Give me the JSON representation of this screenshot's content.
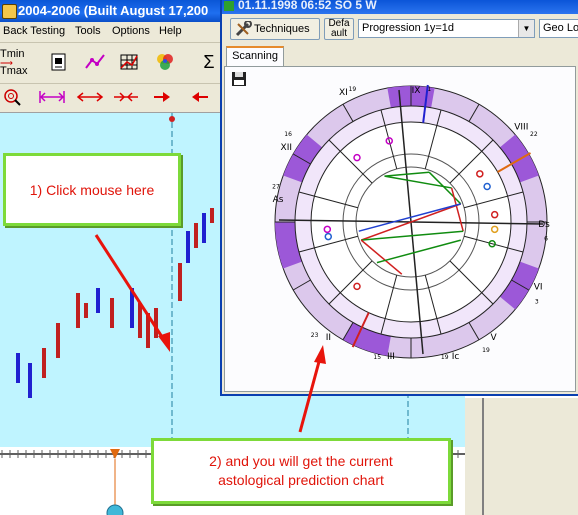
{
  "app": {
    "title": "2004-2006 (Built August 17,200"
  },
  "menu": {
    "items": [
      "Back Testing",
      "Tools",
      "Options",
      "Help"
    ]
  },
  "toolbar": {
    "tmin_label": "Tmin",
    "tmax_label": "Tmax",
    "sigma_label": "Σ"
  },
  "popup": {
    "title": "01.11.1998  06:52 SO  5 W",
    "techniques_label": "Techniques",
    "default_label_1": "Defa",
    "default_label_2": "ault",
    "progression_value": "Progression 1y=1d",
    "geo_value": "Geo Lon",
    "tab_label": "Scanning"
  },
  "wheel": {
    "house_labels": [
      "IX",
      "VIII",
      "XI",
      "XII",
      "As",
      "Ds",
      "II",
      "III",
      "Ic",
      "V",
      "VI"
    ],
    "degree_labels": [
      "1",
      "22",
      "19",
      "16",
      "27",
      "6",
      "23",
      "15",
      "19",
      "19",
      "3"
    ]
  },
  "callouts": {
    "step1": "1) Click mouse here",
    "step2_line1": "2) and you will get the current",
    "step2_line2": "astological prediction chart"
  },
  "colors": {
    "chart_bg": "#bff4ff",
    "callout_border": "#7dda3a",
    "callout_text": "#e0140a",
    "arrow": "#e8140c",
    "titlebar": "#1f6ff0"
  }
}
